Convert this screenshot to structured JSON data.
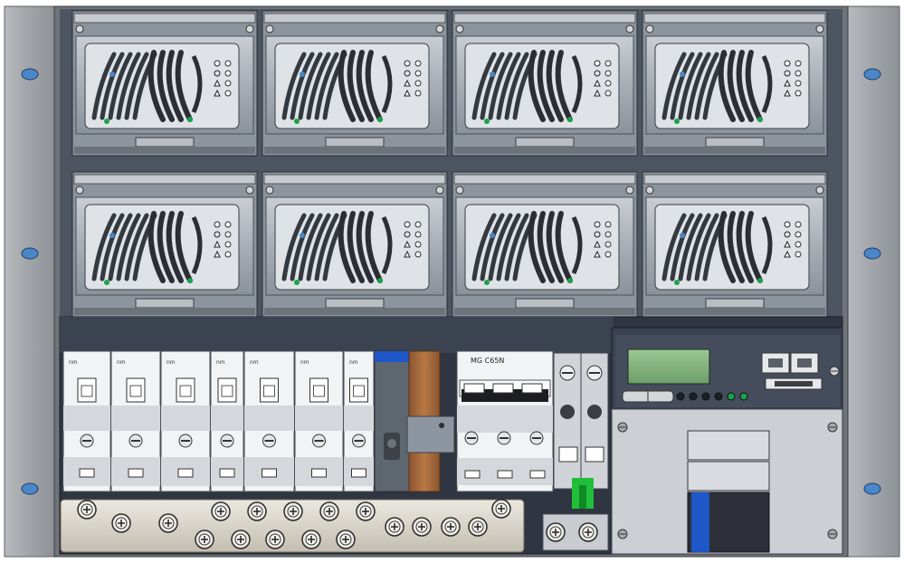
{
  "rack": {
    "colors": {
      "ear": "#9ea1a6",
      "ear_hole": "#4a86c8",
      "frame": "#7d8086",
      "backplane": "#2d3340",
      "rectifier_body": "#a9b0b8",
      "rectifier_dark": "#3b3f46",
      "breaker_body": "#f2f3f4",
      "busbar": "#d6d2c8",
      "copper": "#a86a3c",
      "lcd": "#7fb07c",
      "led_green": "#19a34a",
      "blue_accent": "#1f56c8"
    }
  },
  "rectifiers": {
    "rows": 2,
    "columns": 4,
    "icons": [
      "sun-icon",
      "circle-icon",
      "warning-triangle-icon",
      "warning-triangle-icon"
    ]
  },
  "breakers": {
    "single_pole_count": 7,
    "single_pole_labels": [
      "nm",
      "nm",
      "nm",
      "nm",
      "nm",
      "nm",
      "nm"
    ],
    "three_pole_label": "MG C65N"
  },
  "controller": {
    "ports": [
      "rj45-port-1",
      "rj45-port-2",
      "db25-port"
    ],
    "leds": [
      "led-1",
      "led-2",
      "led-3",
      "led-4",
      "led-5",
      "led-6"
    ]
  }
}
